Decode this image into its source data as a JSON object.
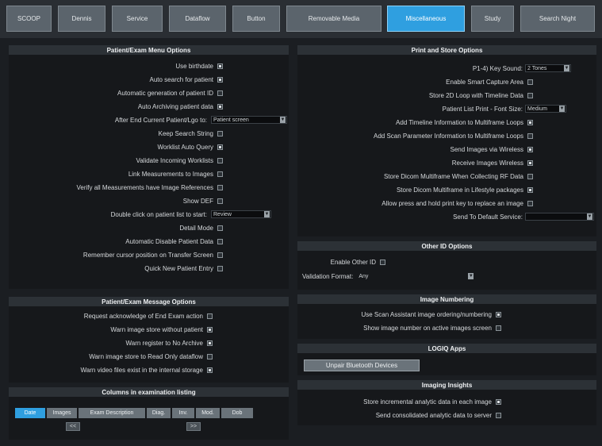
{
  "tabs": [
    {
      "label": "SCOOP"
    },
    {
      "label": "Dennis"
    },
    {
      "label": "Service"
    },
    {
      "label": "Dataflow"
    },
    {
      "label": "Button"
    },
    {
      "label": "Removable Media"
    },
    {
      "label": "Miscellaneous"
    },
    {
      "label": "Study"
    },
    {
      "label": "Search Night"
    }
  ],
  "menu_options": {
    "title": "Patient/Exam Menu Options",
    "rows": [
      {
        "label": "Use birthdate",
        "checked": true
      },
      {
        "label": "Auto search for patient",
        "checked": true
      },
      {
        "label": "Automatic generation of patient ID",
        "checked": false
      },
      {
        "label": "Auto Archiving patient data",
        "checked": true
      },
      {
        "label": "After End Current Patient/Lgo to:",
        "dropdown": "Patient screen"
      },
      {
        "label": "Keep Search String",
        "checked": false
      },
      {
        "label": "Worklist Auto Query",
        "checked": true
      },
      {
        "label": "Validate Incoming Worklists",
        "checked": false
      },
      {
        "label": "Link Measurements to Images",
        "checked": false
      },
      {
        "label": "Verify all Measurements have Image References",
        "checked": false
      },
      {
        "label": "Show DEF",
        "checked": false
      },
      {
        "label": "Double click on patient list to start:",
        "dropdown": "Review"
      },
      {
        "label": "Detail Mode",
        "checked": false
      },
      {
        "label": "Automatic Disable Patient Data",
        "checked": false
      },
      {
        "label": "Remember cursor position on Transfer Screen",
        "checked": false
      },
      {
        "label": "Quick New Patient Entry",
        "checked": false
      }
    ]
  },
  "message_options": {
    "title": "Patient/Exam Message Options",
    "rows": [
      {
        "label": "Request acknowledge of End Exam action",
        "checked": false
      },
      {
        "label": "Warn image store without patient",
        "checked": true
      },
      {
        "label": "Warn register to No Archive",
        "checked": true
      },
      {
        "label": "Warn image store to Read Only dataflow",
        "checked": false
      },
      {
        "label": "Warn video files exist in the internal storage",
        "checked": true
      }
    ]
  },
  "columns_listing": {
    "title": "Columns in examination listing",
    "columns": [
      "Date",
      "Images",
      "Exam Description",
      "Diag.",
      "Inv.",
      "Mod.",
      "Dob"
    ],
    "scroll_left": "<<",
    "scroll_right": ">>"
  },
  "print_store": {
    "title": "Print and Store Options",
    "rows": [
      {
        "label": "P1-4) Key Sound:",
        "dropdown": "2 Tones"
      },
      {
        "label": "Enable Smart Capture Area",
        "checked": false
      },
      {
        "label": "Store 2D Loop with Timeline Data",
        "checked": false
      },
      {
        "label": "Patient List Print - Font Size:",
        "dropdown": "Medium"
      },
      {
        "label": "Add Timeline Information to Multiframe Loops",
        "checked": true
      },
      {
        "label": "Add Scan Parameter Information to Multiframe Loops",
        "checked": false
      },
      {
        "label": "Send Images via Wireless",
        "checked": true
      },
      {
        "label": "Receive Images Wireless",
        "checked": true
      },
      {
        "label": "Store Dicom Multiframe When Collecting RF Data",
        "checked": false
      },
      {
        "label": "Store Dicom Multiframe in Lifestyle packages",
        "checked": true
      },
      {
        "label": "Allow press and hold print key to replace an image",
        "checked": false
      },
      {
        "label": "Send To Default Service:",
        "dropdown": ""
      }
    ]
  },
  "other_id": {
    "title": "Other ID Options",
    "enable_label": "Enable Other ID",
    "enable_checked": false,
    "validation_label": "Validation Format:",
    "validation_value": "Any"
  },
  "image_numbering": {
    "title": "Image Numbering",
    "rows": [
      {
        "label": "Use Scan Assistant image ordering/numbering",
        "checked": true
      },
      {
        "label": "Show image number on active images screen",
        "checked": false
      }
    ]
  },
  "logiq_apps": {
    "title": "LOGIQ Apps",
    "button": "Unpair Bluetooth Devices"
  },
  "imaging_insights": {
    "title": "Imaging Insights",
    "rows": [
      {
        "label": "Store incremental analytic data in each image",
        "checked": true
      },
      {
        "label": "Send consolidated analytic data to server",
        "checked": false
      }
    ]
  }
}
